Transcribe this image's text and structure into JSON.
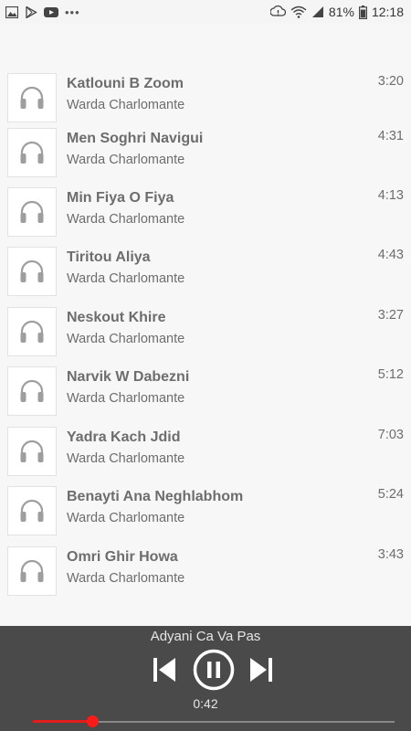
{
  "status_bar": {
    "battery": "81%",
    "time": "12:18",
    "left_icons": [
      "gallery-icon",
      "play-store-icon",
      "youtube-icon",
      "more-dots-icon"
    ],
    "right_icons": [
      "sync-alert-icon",
      "wifi-icon",
      "cellular-signal-icon",
      "battery-icon"
    ]
  },
  "tracks": [
    {
      "title": "Katlouni B Zoom",
      "artist": "Warda Charlomante",
      "duration": "3:20"
    },
    {
      "title": "Men Soghri Navigui",
      "artist": "Warda Charlomante",
      "duration": "4:31"
    },
    {
      "title": "Min Fiya O Fiya",
      "artist": "Warda Charlomante",
      "duration": "4:13"
    },
    {
      "title": "Tiritou Aliya",
      "artist": "Warda Charlomante",
      "duration": "4:43"
    },
    {
      "title": "Neskout Khire",
      "artist": "Warda Charlomante",
      "duration": "3:27"
    },
    {
      "title": "Narvik W Dabezni",
      "artist": "Warda Charlomante",
      "duration": "5:12"
    },
    {
      "title": "Yadra Kach Jdid",
      "artist": "Warda Charlomante",
      "duration": "7:03"
    },
    {
      "title": "Benayti Ana Neghlabhom",
      "artist": "Warda Charlomante",
      "duration": "5:24"
    },
    {
      "title": "Omri Ghir Howa",
      "artist": "Warda Charlomante",
      "duration": "3:43"
    }
  ],
  "track_icon": "headphones-icon",
  "player": {
    "now_playing": "Adyani Ca Va Pas",
    "elapsed": "0:42",
    "progress_fraction": 0.165,
    "state": "playing",
    "controls": [
      "skip-previous-icon",
      "pause-icon",
      "skip-next-icon"
    ]
  },
  "colors": {
    "player_bg": "#4a4a4a",
    "seek_accent": "#e21b1b",
    "text_gray": "#6d6d6d"
  }
}
